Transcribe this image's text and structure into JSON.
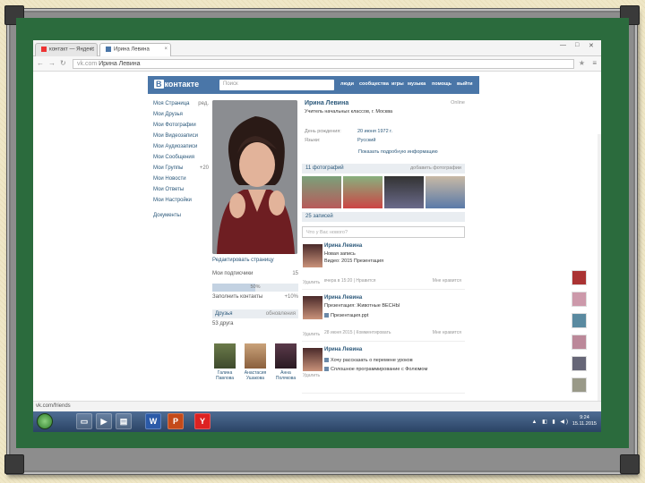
{
  "browser": {
    "tabs": [
      {
        "label": "контакт — Яндекс"
      },
      {
        "label": "Ирина Левина"
      }
    ],
    "url_domain": "vk.com",
    "url_title": "Ирина Левина"
  },
  "vk": {
    "logo": "контакте",
    "logo_prefix": "В",
    "search_placeholder": "Поиск",
    "nav": [
      "люди",
      "сообщества",
      "игры",
      "музыка",
      "помощь",
      "выйти"
    ]
  },
  "left_menu": [
    {
      "label": "Моя Страница",
      "count": "ред."
    },
    {
      "label": "Мои Друзья",
      "count": ""
    },
    {
      "label": "Мои Фотографии",
      "count": ""
    },
    {
      "label": "Мои Видеозаписи",
      "count": ""
    },
    {
      "label": "Мои Аудиозаписи",
      "count": ""
    },
    {
      "label": "Мои Сообщения",
      "count": ""
    },
    {
      "label": "Мои Группы",
      "count": "+20"
    },
    {
      "label": "Мои Новости",
      "count": ""
    },
    {
      "label": "Мои Ответы",
      "count": ""
    },
    {
      "label": "Мои Настройки",
      "count": ""
    },
    {
      "label": "Документы",
      "count": ""
    }
  ],
  "profile": {
    "name": "Ирина Левина",
    "online": "Online",
    "status": "Учитель начальных классов, г. Москва",
    "birthday_label": "День рождения:",
    "birthday": "20 июня 1972 г.",
    "lang_label": "Языки:",
    "lang": "Русский",
    "more": "Показать подробную информацию",
    "edit": "Редактировать страницу",
    "subscribers_label": "Мои подписчики",
    "subscribers_count": "15",
    "progress_value": 50,
    "progress_text": "50%",
    "fill_label": "Заполнить контакты",
    "fill_value": "+10%",
    "friends_title": "Друзья",
    "friends_update": "обновления",
    "friends_count": "53 друга",
    "friends": [
      "Галина Павлова",
      "Анастасия Ушакова",
      "Анна Полякова"
    ],
    "photos_title": "11 фотографий",
    "photos_action": "добавить фотографии",
    "wall_title": "25 записей",
    "wall_placeholder": "Что у Вас нового?"
  },
  "posts": [
    {
      "author": "Ирина Левина",
      "line1": "Ирина Левина",
      "line2": "Новая запись",
      "line3": "Видео: 2015 Презентация",
      "meta": "вчера в 15:20 | Нравится",
      "right": "Мне нравится",
      "del": "Удалить"
    },
    {
      "author": "Ирина Левина",
      "line1": "Презентация: Животные ВЕСНЫ",
      "line2": "Презентация.ppt",
      "line3": "",
      "meta": "28 июня 2015 | Комментировать",
      "right": "Мне нравится",
      "del": "Удалить"
    },
    {
      "author": "Ирина Левина",
      "line1": "Хочу рассказать о перемене уроков",
      "line2": "Сплошное программирование с Фолюмом",
      "line3": "",
      "meta": "",
      "right": "",
      "del": "Удалить"
    }
  ],
  "download_bar": "vk.com/friends",
  "taskbar": {
    "time": "9:24",
    "date": "15.11.2015",
    "apps": [
      "IE",
      "W",
      "P",
      "Y"
    ]
  },
  "colors": {
    "vk_blue": "#4a76a8",
    "board_green": "#2b6b3d",
    "frame_gray": "#8d8d8d"
  }
}
